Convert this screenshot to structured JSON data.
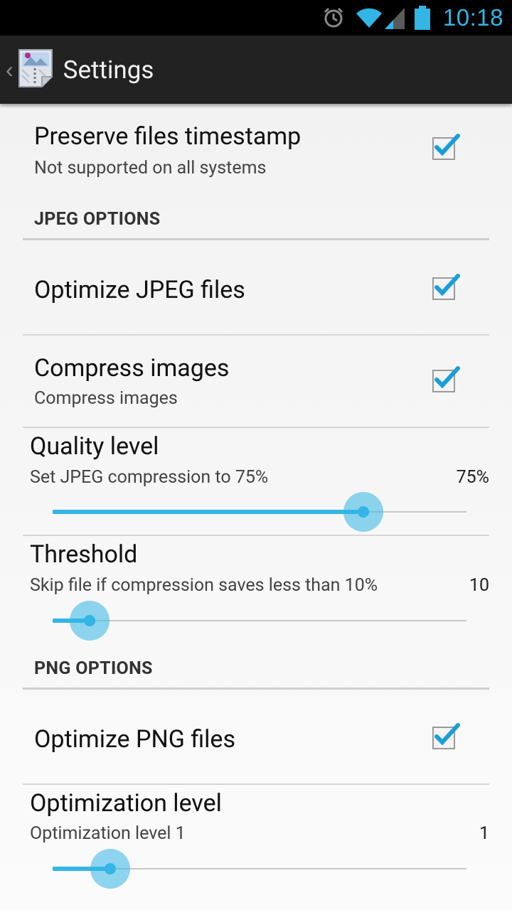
{
  "status_bar": {
    "time": "10:18",
    "icons": [
      "alarm-icon",
      "wifi-icon",
      "cell-signal-icon",
      "battery-icon"
    ]
  },
  "action_bar": {
    "title": "Settings",
    "app_icon": "zip-archive-icon",
    "up_icon": "chevron-left-icon"
  },
  "prefs": {
    "preserve_timestamp": {
      "title": "Preserve files timestamp",
      "summary": "Not supported on all systems",
      "checked": true
    },
    "jpeg_header": "JPEG OPTIONS",
    "optimize_jpeg": {
      "title": "Optimize JPEG files",
      "checked": true
    },
    "compress_images": {
      "title": "Compress images",
      "summary": "Compress images",
      "checked": true
    },
    "quality_level": {
      "title": "Quality level",
      "summary": "Set JPEG compression to 75%",
      "value_label": "75%",
      "fraction": 0.75
    },
    "threshold": {
      "title": "Threshold",
      "summary": "Skip file if compression saves less than 10%",
      "value_label": "10",
      "fraction": 0.09
    },
    "png_header": "PNG OPTIONS",
    "optimize_png": {
      "title": "Optimize PNG files",
      "checked": true
    },
    "optimization_level": {
      "title": "Optimization level",
      "summary": "Optimization level 1",
      "value_label": "1",
      "fraction": 0.14
    }
  },
  "colors": {
    "accent": "#33b5e5",
    "action_bar": "#222222",
    "status_bar": "#000000"
  }
}
